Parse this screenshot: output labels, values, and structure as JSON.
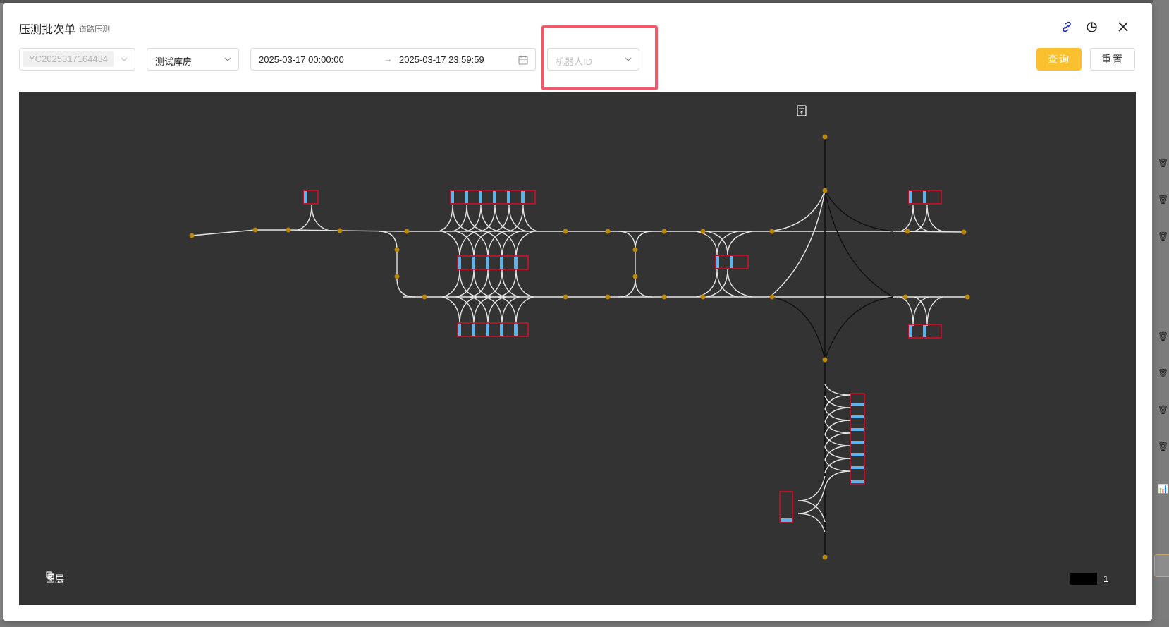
{
  "modal": {
    "title": "压测批次单",
    "subtitle": "道路压测"
  },
  "filters": {
    "batch_value": "YC2025317164434",
    "warehouse_value": "测试库房",
    "date_start": "2025-03-17 00:00:00",
    "date_end": "2025-03-17 23:59:59",
    "range_separator": "→",
    "robot_placeholder": "机器人ID"
  },
  "buttons": {
    "query": "查询",
    "reset": "重置"
  },
  "map": {
    "layers_label": "图层",
    "scale_label": "1"
  },
  "colors": {
    "accent": "#fbc02d",
    "highlight": "#ef5a6a",
    "map_bg": "#333333",
    "node": "#b8860b",
    "slot_fill": "#5ab4f0",
    "slot_border": "#d01028"
  }
}
